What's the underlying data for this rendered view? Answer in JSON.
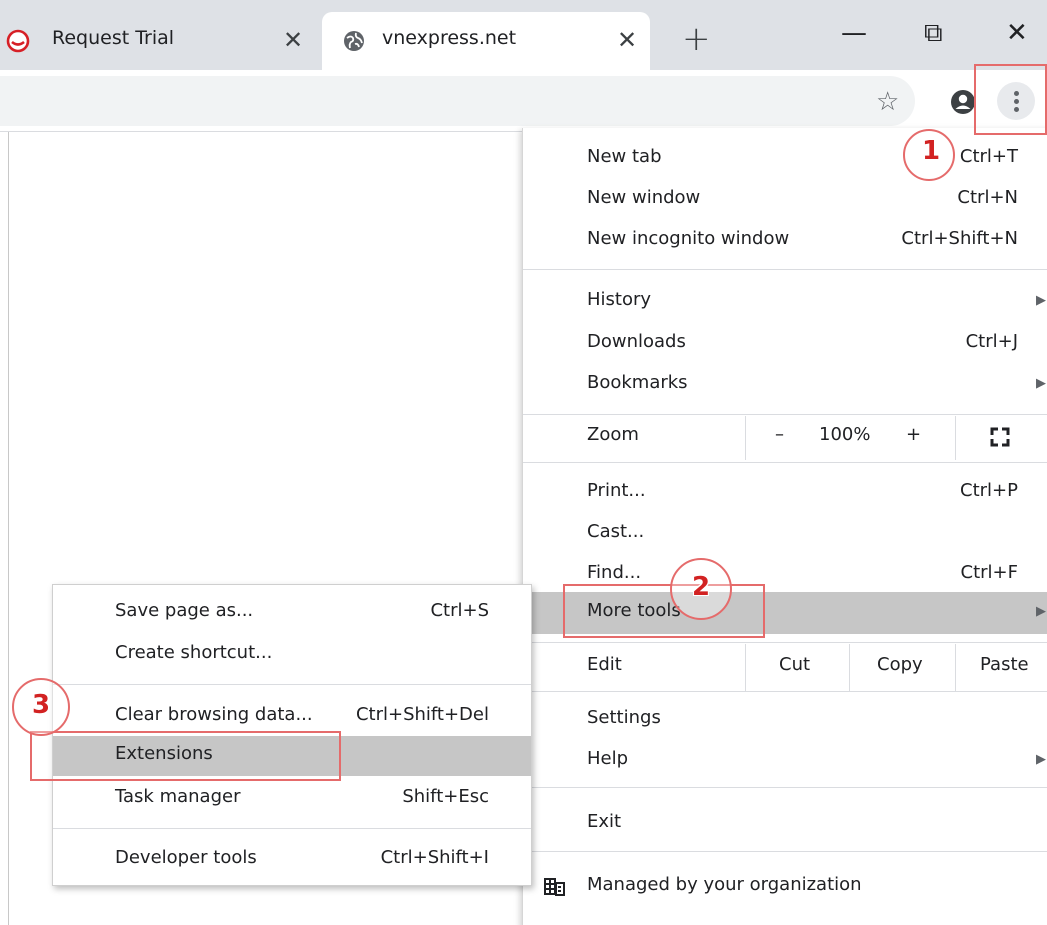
{
  "tabs": [
    {
      "title": "Request Trial",
      "icon": "red-logo-icon",
      "active": false
    },
    {
      "title": "vnexpress.net",
      "icon": "globe-icon",
      "active": true
    }
  ],
  "tab_close_glyph": "✕",
  "new_tab_glyph": "+",
  "window_controls": {
    "minimize": "—",
    "restore": "⧉",
    "close": "✕"
  },
  "toolbar": {
    "bookmark_glyph": "☆"
  },
  "main_menu": {
    "new_tab": {
      "label": "New tab",
      "shortcut": "Ctrl+T"
    },
    "new_window": {
      "label": "New window",
      "shortcut": "Ctrl+N"
    },
    "new_incognito": {
      "label": "New incognito window",
      "shortcut": "Ctrl+Shift+N"
    },
    "history": {
      "label": "History"
    },
    "downloads": {
      "label": "Downloads",
      "shortcut": "Ctrl+J"
    },
    "bookmarks": {
      "label": "Bookmarks"
    },
    "zoom": {
      "label": "Zoom",
      "minus": "–",
      "value": "100%",
      "plus": "+"
    },
    "print": {
      "label": "Print...",
      "shortcut": "Ctrl+P"
    },
    "cast": {
      "label": "Cast..."
    },
    "find": {
      "label": "Find...",
      "shortcut": "Ctrl+F"
    },
    "more_tools": {
      "label": "More tools"
    },
    "edit": {
      "label": "Edit",
      "cut": "Cut",
      "copy": "Copy",
      "paste": "Paste"
    },
    "settings": {
      "label": "Settings"
    },
    "help": {
      "label": "Help"
    },
    "exit": {
      "label": "Exit"
    },
    "managed": {
      "label": "Managed by your organization"
    },
    "arrow_glyph": "▶"
  },
  "sub_menu": {
    "save_page": {
      "label": "Save page as...",
      "shortcut": "Ctrl+S"
    },
    "create_shortcut": {
      "label": "Create shortcut..."
    },
    "clear_data": {
      "label": "Clear browsing data...",
      "shortcut": "Ctrl+Shift+Del"
    },
    "extensions": {
      "label": "Extensions"
    },
    "task_manager": {
      "label": "Task manager",
      "shortcut": "Shift+Esc"
    },
    "dev_tools": {
      "label": "Developer tools",
      "shortcut": "Ctrl+Shift+I"
    }
  },
  "annotations": {
    "step1": "1",
    "step2": "2",
    "step3": "3"
  },
  "colors": {
    "annotation": "#e56b6b",
    "highlight": "#c6c6c6",
    "tabstrip": "#dee1e6"
  }
}
